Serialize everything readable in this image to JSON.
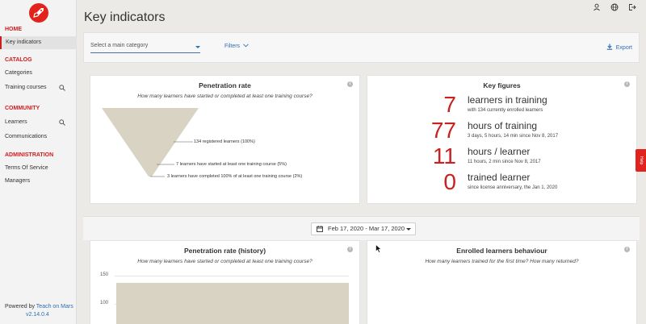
{
  "sidebar": {
    "sections": [
      {
        "label": "HOME",
        "items": [
          {
            "label": "Key indicators",
            "active": true
          }
        ]
      },
      {
        "label": "CATALOG",
        "items": [
          {
            "label": "Categories"
          },
          {
            "label": "Training courses"
          }
        ]
      },
      {
        "label": "COMMUNITY",
        "items": [
          {
            "label": "Learners"
          },
          {
            "label": "Communications"
          }
        ]
      },
      {
        "label": "ADMINISTRATION",
        "items": [
          {
            "label": "Terms Of Service"
          },
          {
            "label": "Managers"
          }
        ]
      }
    ],
    "powered_by": "Powered by",
    "brand": "Teach on Mars",
    "version": "v2.14.0.4"
  },
  "header": {
    "title": "Key indicators"
  },
  "filters": {
    "category_placeholder": "Select a main category",
    "filters_label": "Filters",
    "export_label": "Export"
  },
  "penetration": {
    "title": "Penetration rate",
    "subtitle": "How many learners have started or completed at least one training course?",
    "labels": [
      "134 registered learners (100%)",
      "7 learners have started at least one training course (5%)",
      "3 learners have completed 100% of at least one training course (2%)"
    ]
  },
  "key_figures": {
    "title": "Key figures",
    "rows": [
      {
        "value": "7",
        "label": "learners in training",
        "sub": "with 134 currently enrolled learners"
      },
      {
        "value": "77",
        "label": "hours of training",
        "sub": "3 days, 5 hours, 14 min since Nov 8, 2017"
      },
      {
        "value": "11",
        "label": "hours / learner",
        "sub": "11 hours, 2 min since Nov 8, 2017"
      },
      {
        "value": "0",
        "label": "trained learner",
        "sub": "since license anniversary, the Jan 1, 2020"
      }
    ]
  },
  "date_range": {
    "label": "Feb 17, 2020 - Mar 17, 2020"
  },
  "history": {
    "title": "Penetration rate (history)",
    "subtitle": "How many learners have started or completed at least one training course?",
    "y_ticks": [
      "150",
      "100"
    ]
  },
  "behaviour": {
    "title": "Enrolled learners behaviour",
    "subtitle": "How many learners trained for the first time? How many returned?"
  },
  "help": {
    "label": "Help"
  },
  "colors": {
    "accent": "#cc1f1f",
    "link": "#2f6fb4",
    "funnel": "#d9d3c4"
  }
}
